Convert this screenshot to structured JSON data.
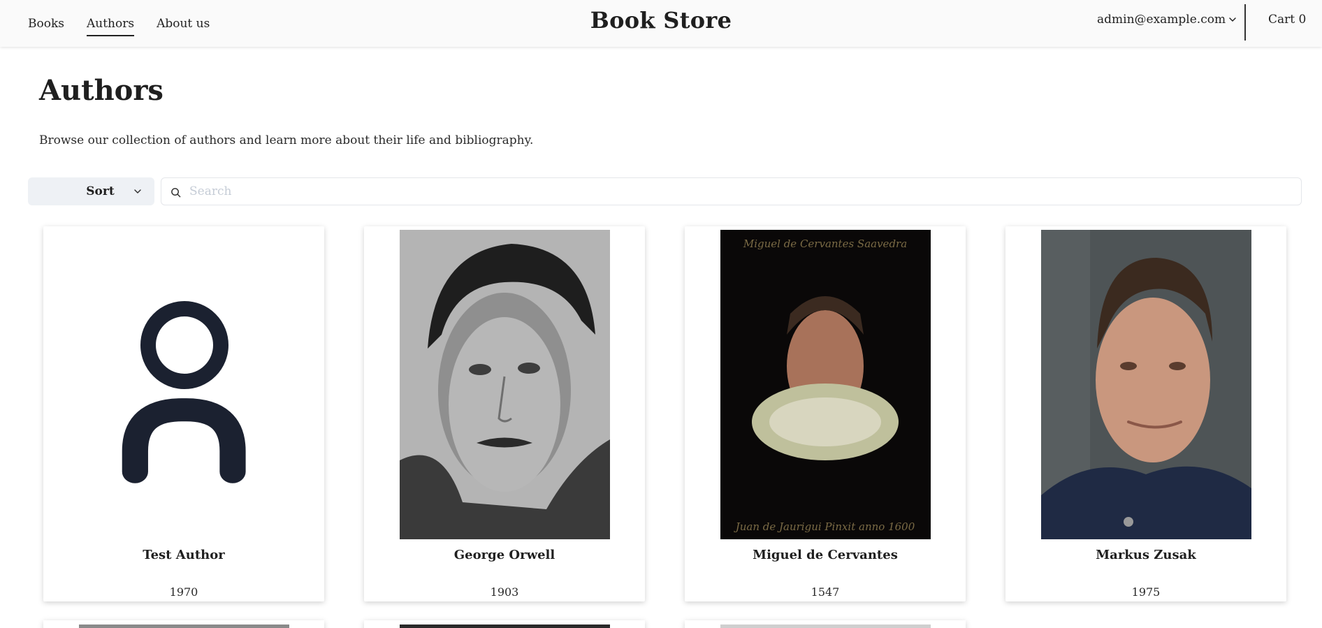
{
  "header": {
    "nav": [
      {
        "label": "Books",
        "active": false
      },
      {
        "label": "Authors",
        "active": true
      },
      {
        "label": "About us",
        "active": false
      }
    ],
    "brand": "Book Store",
    "user_email": "admin@example.com",
    "cart_label": "Cart 0"
  },
  "page": {
    "title": "Authors",
    "subtitle": "Browse our collection of authors and learn more about their life and bibliography."
  },
  "controls": {
    "sort_label": "Sort",
    "search_placeholder": "Search",
    "search_value": ""
  },
  "authors": [
    {
      "name": "Test Author",
      "year": "1970",
      "photo": "placeholder-user-icon"
    },
    {
      "name": "George Orwell",
      "year": "1903",
      "photo": "portrait-bw"
    },
    {
      "name": "Miguel de Cervantes",
      "year": "1547",
      "photo": "portrait-painting"
    },
    {
      "name": "Markus Zusak",
      "year": "1975",
      "photo": "portrait-color"
    }
  ],
  "colors": {
    "header_bg": "#fafafa",
    "sort_bg": "#eef1f5",
    "icon_dark": "#1b2130",
    "placeholder": "#c5ccd6"
  }
}
